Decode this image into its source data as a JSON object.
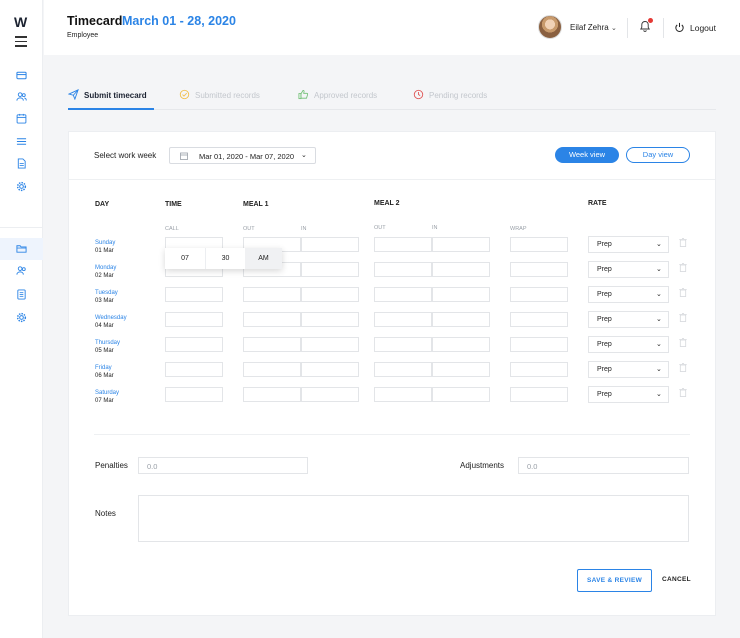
{
  "sidebar": {
    "logo": "W"
  },
  "header": {
    "title": "Timecard",
    "date_range": "March 01 - 28, 2020",
    "role": "Employee",
    "user_name": "Eilaf Zehra",
    "logout": "Logout"
  },
  "tabs": [
    {
      "label": "Submit timecard"
    },
    {
      "label": "Submitted records"
    },
    {
      "label": "Approved records"
    },
    {
      "label": "Pending records"
    }
  ],
  "week": {
    "label": "Select work week",
    "value": "Mar 01, 2020 - Mar 07, 2020",
    "week_view": "Week view",
    "day_view": "Day view"
  },
  "table": {
    "headers": {
      "day": "DAY",
      "time": "TIME",
      "meal1": "MEAL 1",
      "meal2": "MEAL 2",
      "rate": "RATE"
    },
    "sub_headers": {
      "call": "CALL",
      "m1_out": "OUT",
      "m1_in": "IN",
      "m2_out": "OUT",
      "m2_in": "IN",
      "wrap": "WRAP"
    },
    "rows": [
      {
        "day": "Sunday",
        "date": "01 Mar",
        "rate": "Prep"
      },
      {
        "day": "Monday",
        "date": "02 Mar",
        "rate": "Prep"
      },
      {
        "day": "Tuesday",
        "date": "03 Mar",
        "rate": "Prep"
      },
      {
        "day": "Wednesday",
        "date": "04 Mar",
        "rate": "Prep"
      },
      {
        "day": "Thursday",
        "date": "05 Mar",
        "rate": "Prep"
      },
      {
        "day": "Friday",
        "date": "06 Mar",
        "rate": "Prep"
      },
      {
        "day": "Saturday",
        "date": "07 Mar",
        "rate": "Prep"
      }
    ]
  },
  "time_picker": {
    "hour": "07",
    "minute": "30",
    "period": "AM"
  },
  "penalties": {
    "label": "Penalties",
    "value": "0.0"
  },
  "adjustments": {
    "label": "Adjustments",
    "value": "0.0"
  },
  "notes": {
    "label": "Notes"
  },
  "actions": {
    "save": "SAVE & REVIEW",
    "cancel": "CANCEL"
  },
  "colors": {
    "accent": "#2b84e6",
    "notification": "#e53935",
    "submitted_icon": "#f2c14e",
    "approved_icon": "#6fbf73",
    "pending_icon": "#e05a5a"
  }
}
